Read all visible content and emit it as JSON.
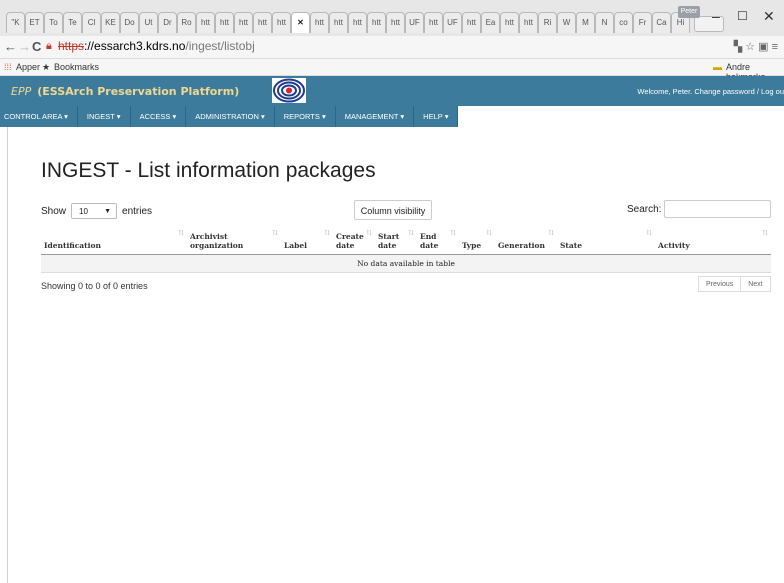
{
  "browser": {
    "tabs": [
      "\"K",
      "ET",
      "To",
      "Te",
      "Cl",
      "KE",
      "Do",
      "Ut",
      "Dr",
      "Ro",
      "htt",
      "htt",
      "htt",
      "htt",
      "htt",
      "✕",
      "htt",
      "htt",
      "htt",
      "htt",
      "htt",
      "UF",
      "htt",
      "UF",
      "htt",
      "Ea",
      "htt",
      "htt",
      "Ri",
      "W",
      "M",
      "N",
      "co",
      "Fr",
      "Ca",
      "Hi"
    ],
    "active_tab_index": 15,
    "user_badge": "Peter",
    "url_scheme": "https",
    "url_host": "://essarch3.kdrs.no",
    "url_path": "/ingest/listobj",
    "bookmarks": {
      "apps": "Apper",
      "bookmarks": "Bookmarks",
      "other": "Andre bokmerke"
    }
  },
  "app": {
    "epp": "EPP",
    "title": "(ESSArch Preservation Platform)",
    "welcome": "Welcome, Peter. Change password / Log ou"
  },
  "menu": [
    "CONTROL AREA ▾",
    "INGEST ▾",
    "ACCESS ▾",
    "ADMINISTRATION ▾",
    "REPORTS ▾",
    "MANAGEMENT ▾",
    "HELP ▾"
  ],
  "page": {
    "title": "INGEST - List information packages",
    "show_label": "Show",
    "entries_value": "10",
    "entries_label": "entries",
    "column_visibility": "Column visibility",
    "search_label": "Search:",
    "columns": [
      "Identification",
      "Archivist organization",
      "Label",
      "Create date",
      "Start date",
      "End date",
      "Type",
      "Generation",
      "State",
      "Activity"
    ],
    "empty_message": "No data available in table",
    "info": "Showing 0 to 0 of 0 entries",
    "prev": "Previous",
    "next": "Next"
  }
}
